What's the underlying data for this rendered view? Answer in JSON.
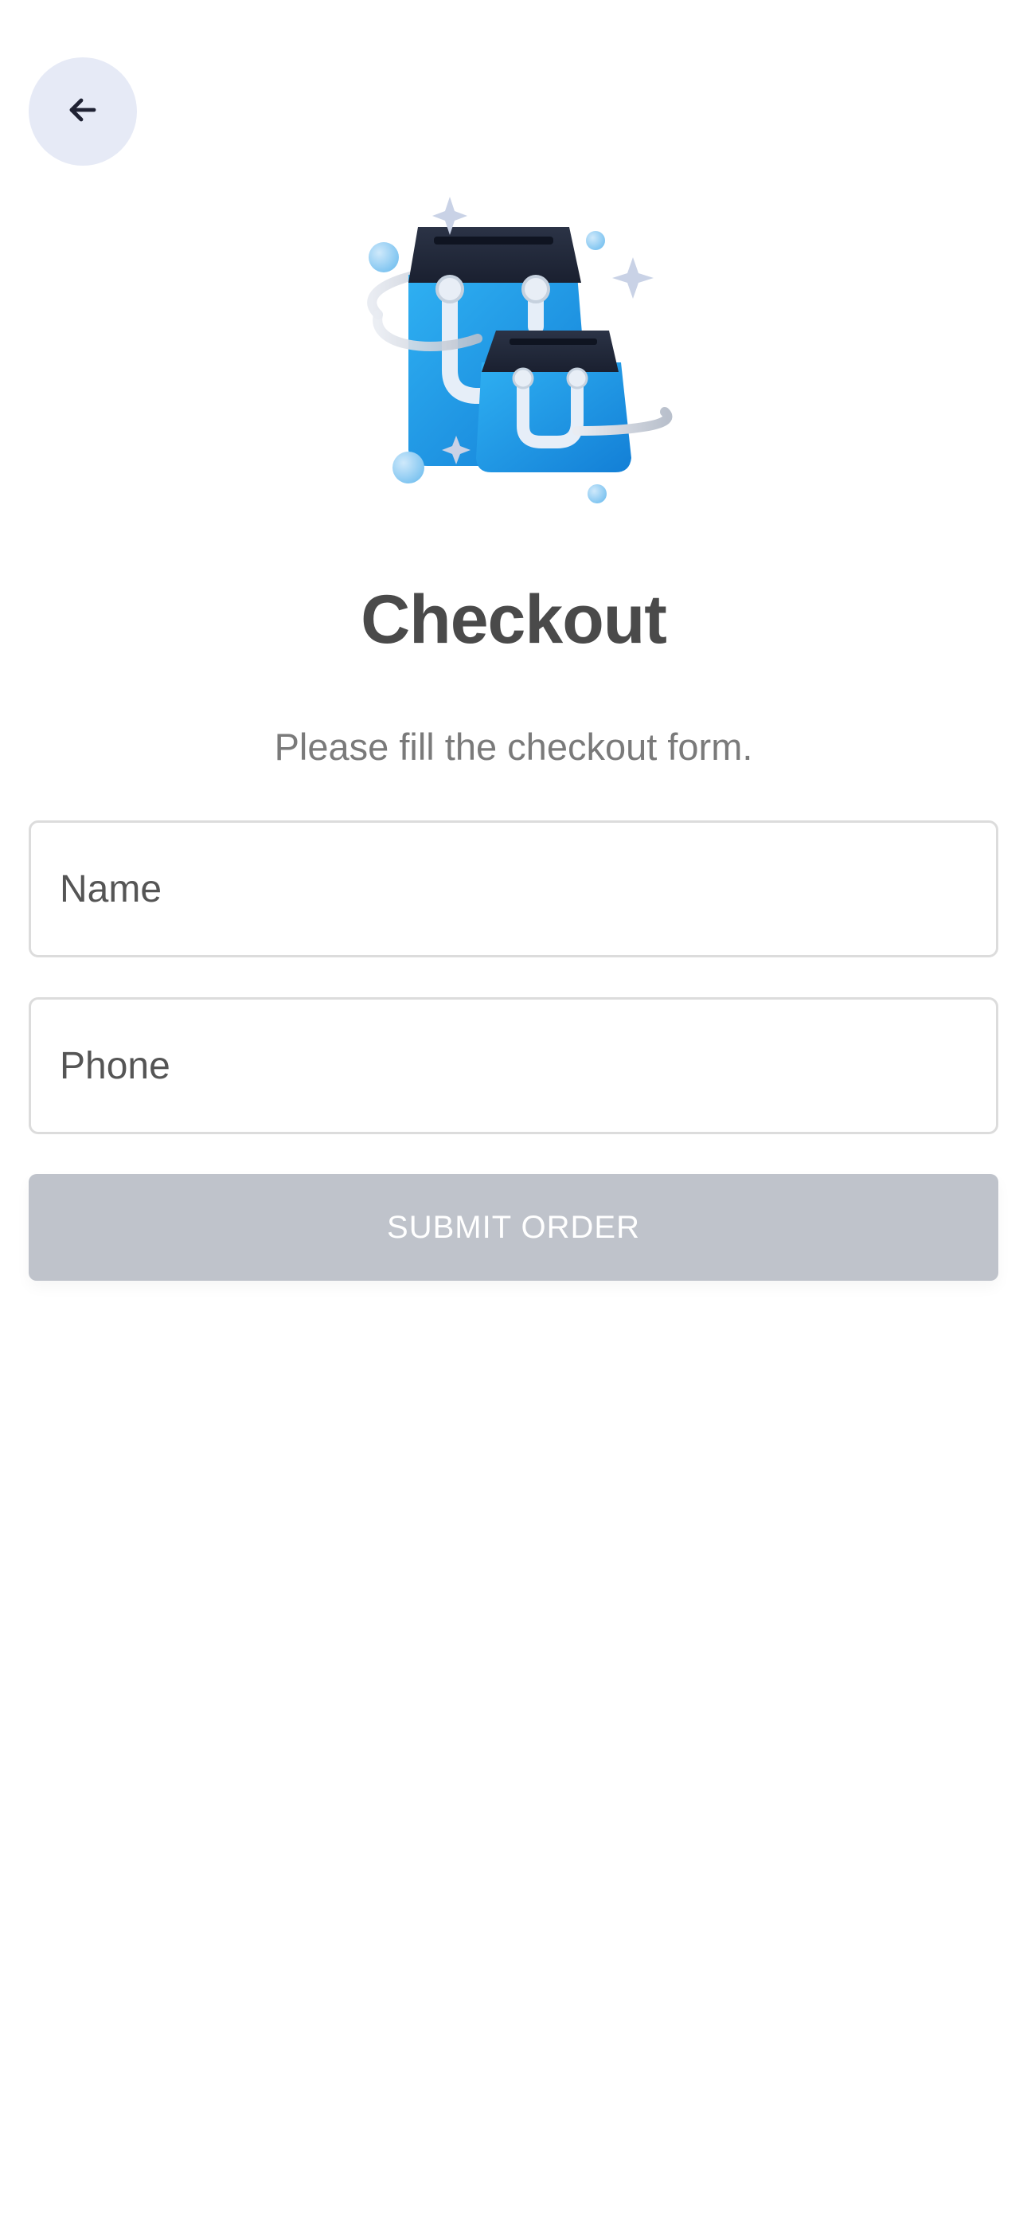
{
  "header": {
    "back_icon": "arrow-left-icon"
  },
  "hero": {
    "icon": "shopping-bags-illustration"
  },
  "checkout": {
    "title": "Checkout",
    "subtitle": "Please fill the checkout form."
  },
  "form": {
    "name_placeholder": "Name",
    "name_value": "",
    "phone_placeholder": "Phone",
    "phone_value": "",
    "submit_label": "SUBMIT ORDER",
    "submit_enabled": false
  },
  "colors": {
    "accent_blue": "#1e9be6",
    "back_button_bg": "#e6eaf6",
    "submit_disabled_bg": "#bfc3cb",
    "title_text": "#4a4a4a",
    "subtitle_text": "#7a7a7a",
    "field_border": "#dcdcdc"
  }
}
